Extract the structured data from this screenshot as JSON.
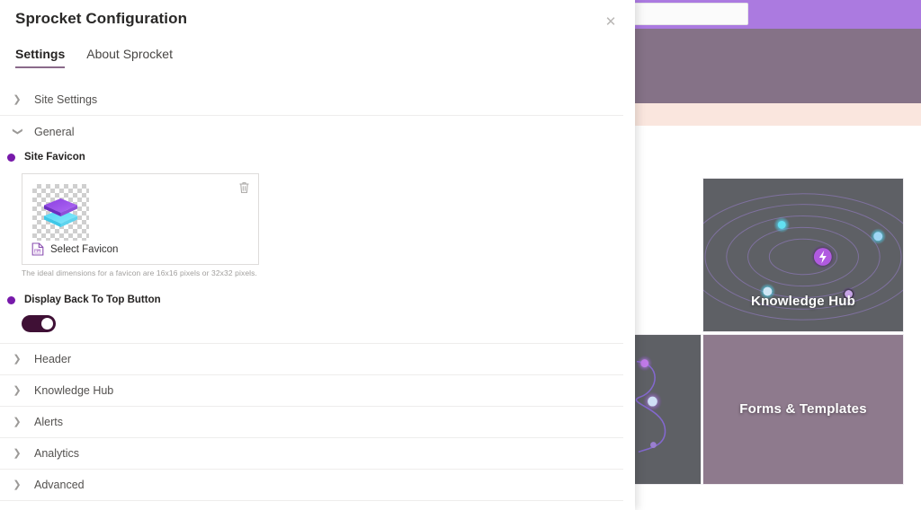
{
  "panel": {
    "title": "Sprocket Configuration",
    "close_icon": "close-icon",
    "tabs": [
      {
        "label": "Settings",
        "active": true
      },
      {
        "label": "About Sprocket",
        "active": false
      }
    ]
  },
  "sections": {
    "site_settings": {
      "label": "Site Settings",
      "expanded": false,
      "chevron": "chevron-right-icon"
    },
    "general": {
      "label": "General",
      "expanded": true,
      "chevron": "chevron-down-icon"
    },
    "collapsed": [
      {
        "label": "Header",
        "chevron": "chevron-right-icon"
      },
      {
        "label": "Knowledge Hub",
        "chevron": "chevron-right-icon"
      },
      {
        "label": "Alerts",
        "chevron": "chevron-right-icon"
      },
      {
        "label": "Analytics",
        "chevron": "chevron-right-icon"
      },
      {
        "label": "Advanced",
        "chevron": "chevron-right-icon"
      }
    ]
  },
  "settings": {
    "favicon": {
      "label": "Site Favicon",
      "select_label": "Select Favicon",
      "select_icon": "image-picker-icon",
      "delete_icon": "trash-icon",
      "hint": "The ideal dimensions for a favicon are 16x16 pixels or 32x32 pixels.",
      "preview_icon": "layers-stack-logo"
    },
    "back_to_top": {
      "label": "Display Back To Top Button",
      "toggle_state": "on"
    }
  },
  "background": {
    "cards": [
      {
        "title": "Knowledge Hub",
        "style": "graphic"
      },
      {
        "title": "Forms & Templates",
        "style": "mauve"
      }
    ],
    "search_placeholder": ""
  },
  "colors": {
    "accent_purple": "#7719aa",
    "toggle_on": "#3f1035",
    "tab_underline": "#8a6a8a",
    "topbar": "#ab7ae0",
    "hero": "#857287",
    "peach": "#fae6de",
    "card_mauve": "#8e7a8d",
    "card_dark": "#5e6065"
  }
}
